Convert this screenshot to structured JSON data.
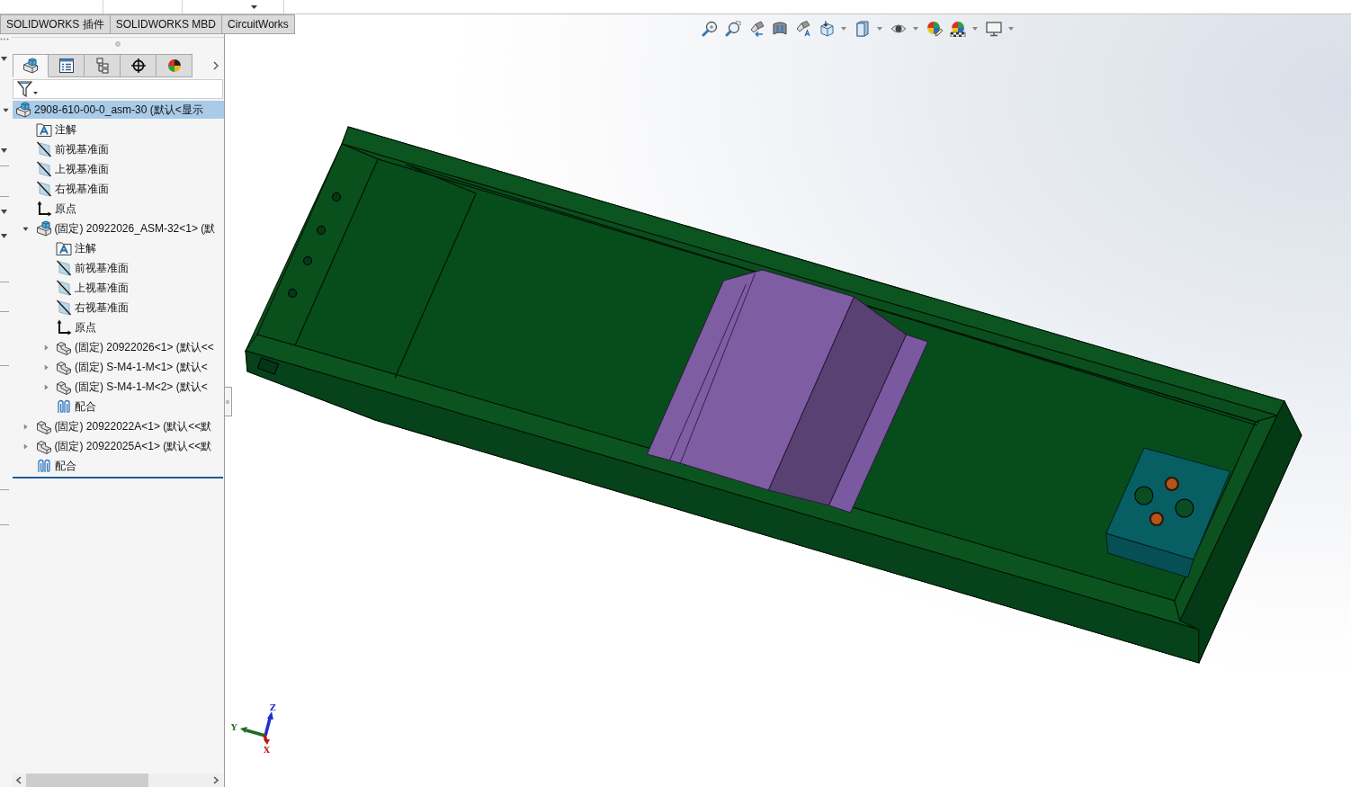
{
  "command_tabs": [
    {
      "label": "SOLIDWORKS 插件",
      "selected": false
    },
    {
      "label": "SOLIDWORKS MBD",
      "selected": false
    },
    {
      "label": "CircuitWorks",
      "selected": false
    }
  ],
  "panel_tabs": [
    {
      "kind": "feature-tree",
      "selected": true
    },
    {
      "kind": "property-list",
      "selected": false
    },
    {
      "kind": "configuration",
      "selected": false
    },
    {
      "kind": "crosshair",
      "selected": false
    },
    {
      "kind": "display",
      "selected": false
    }
  ],
  "tree": [
    {
      "label": "2908-610-00-0_asm-30 (默认<显示",
      "kind": "assembly",
      "expanded": true,
      "selected": true,
      "children": [
        {
          "label": "注解",
          "kind": "annotation",
          "selected": false
        },
        {
          "label": "前视基准面",
          "kind": "plane",
          "selected": false
        },
        {
          "label": "上视基准面",
          "kind": "plane",
          "selected": false
        },
        {
          "label": "右视基准面",
          "kind": "plane",
          "selected": false
        },
        {
          "label": "原点",
          "kind": "origin",
          "selected": false
        },
        {
          "label": "(固定) 20922026_ASM-32<1> (默",
          "kind": "assembly",
          "expanded": true,
          "selected": false,
          "children": [
            {
              "label": "注解",
              "kind": "annotation",
              "selected": false
            },
            {
              "label": "前视基准面",
              "kind": "plane",
              "selected": false
            },
            {
              "label": "上视基准面",
              "kind": "plane",
              "selected": false
            },
            {
              "label": "右视基准面",
              "kind": "plane",
              "selected": false
            },
            {
              "label": "原点",
              "kind": "origin",
              "selected": false
            },
            {
              "label": "(固定) 20922026<1> (默认<<",
              "kind": "part",
              "expanded": false,
              "selected": false
            },
            {
              "label": "(固定) S-M4-1-M<1> (默认<",
              "kind": "part",
              "expanded": false,
              "selected": false
            },
            {
              "label": "(固定) S-M4-1-M<2> (默认<",
              "kind": "part",
              "expanded": false,
              "selected": false
            },
            {
              "label": "配合",
              "kind": "mates",
              "selected": false
            }
          ]
        },
        {
          "label": "(固定) 20922022A<1> (默认<<默",
          "kind": "part",
          "expanded": false,
          "selected": false
        },
        {
          "label": "(固定) 20922025A<1> (默认<<默",
          "kind": "part",
          "expanded": false,
          "selected": false
        },
        {
          "label": "配合",
          "kind": "mates",
          "selected": false
        }
      ]
    }
  ],
  "triad": {
    "x": "X",
    "y": "Y",
    "z": "Z"
  }
}
